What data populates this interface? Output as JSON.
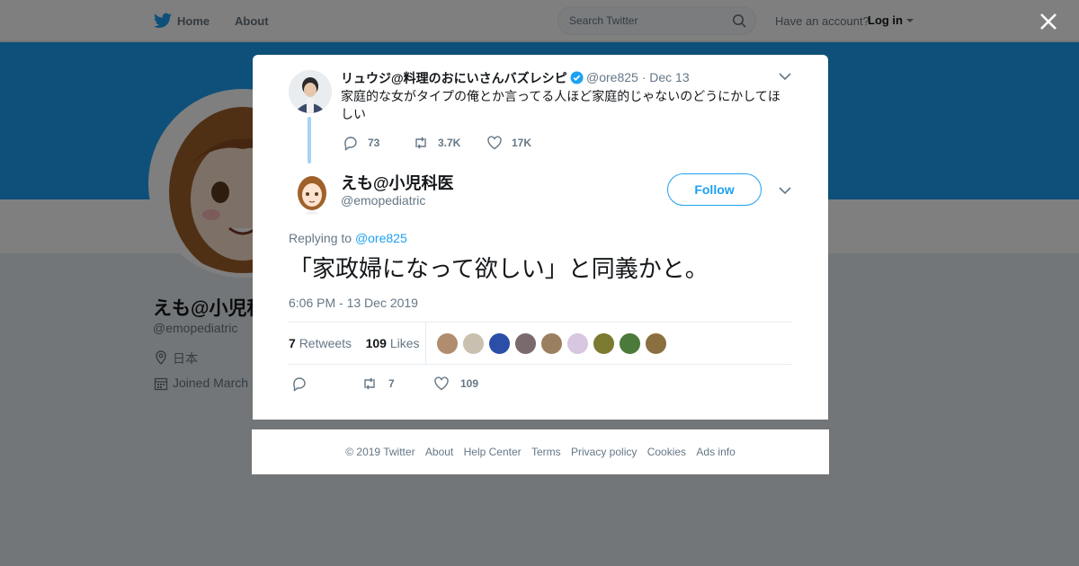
{
  "nav": {
    "home_label": "Home",
    "about_label": "About",
    "search_placeholder": "Search Twitter",
    "have_account": "Have an account?",
    "login_label": "Log in"
  },
  "profile": {
    "name": "えも@小児科医",
    "handle": "@emopediatric",
    "location": "日本",
    "joined": "Joined March"
  },
  "parent_tweet": {
    "name": "リュウジ@料理のおにいさんバズレシピ",
    "handle": "@ore825",
    "separator": "·",
    "date": "Dec 13",
    "text": "家庭的な女がタイプの俺とか言ってる人ほど家庭的じゃないのどうにかしてほしい",
    "replies": "73",
    "retweets": "3.7K",
    "likes": "17K"
  },
  "tweet": {
    "name": "えも@小児科医",
    "handle": "@emopediatric",
    "follow_label": "Follow",
    "replying_prefix": "Replying to",
    "replying_to": "@ore825",
    "text": "「家政婦になって欲しい」と同義かと。",
    "timestamp": "6:06 PM - 13 Dec 2019",
    "retweet_count": "7",
    "retweet_label": "Retweets",
    "like_count": "109",
    "like_label": "Likes",
    "action_retweets": "7",
    "action_likes": "109"
  },
  "likers_colors": [
    "#b08d6e",
    "#c9c0b0",
    "#2b4fa8",
    "#7a6a6e",
    "#9b8060",
    "#d8c7e0",
    "#7b7a30",
    "#4c7a3a",
    "#8a7040"
  ],
  "footer": {
    "copyright": "© 2019 Twitter",
    "about": "About",
    "help": "Help Center",
    "terms": "Terms",
    "privacy": "Privacy policy",
    "cookies": "Cookies",
    "ads": "Ads info"
  },
  "colors": {
    "accent": "#1da1f2",
    "text_secondary": "#657786"
  }
}
